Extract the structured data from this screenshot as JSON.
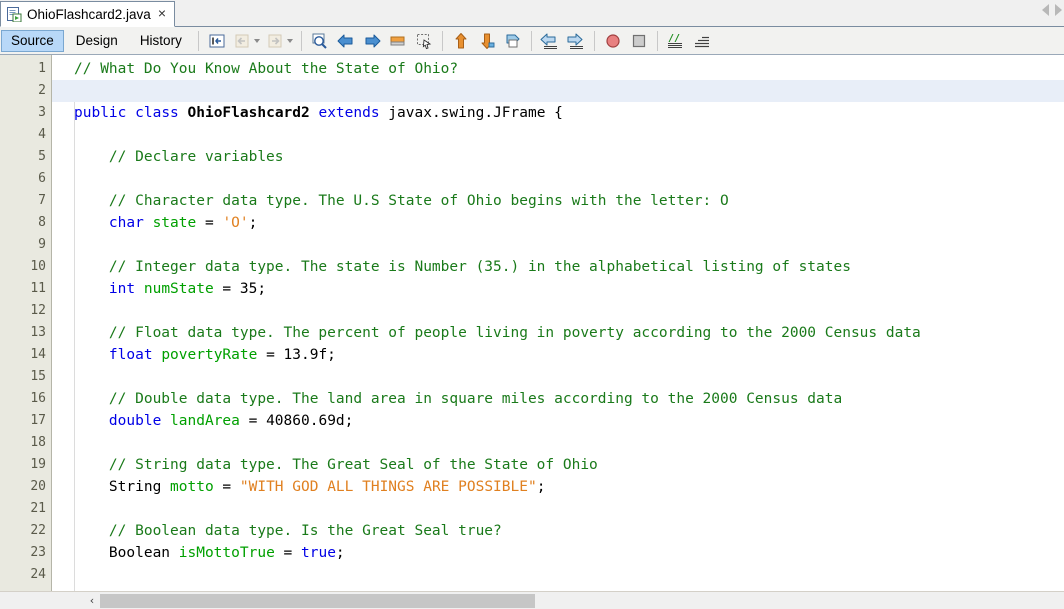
{
  "window": {
    "tab": {
      "title": "OhioFlashcard2.java",
      "close_label": "×",
      "icon": "java-file-icon"
    },
    "tab_nav": {
      "left": "scroll-tabs-left",
      "right": "scroll-tabs-right"
    }
  },
  "view_tabs": [
    {
      "label": "Source",
      "active": true
    },
    {
      "label": "Design",
      "active": false
    },
    {
      "label": "History",
      "active": false
    }
  ],
  "toolbar": {
    "groups": [
      {
        "buttons": [
          {
            "name": "last-edit-icon",
            "enabled": true
          },
          {
            "name": "back-icon",
            "enabled": false,
            "has_caret": true
          },
          {
            "name": "forward-icon",
            "enabled": false,
            "has_caret": true
          }
        ]
      },
      {
        "buttons": [
          {
            "name": "find-selection-icon",
            "enabled": true
          },
          {
            "name": "find-previous-icon",
            "enabled": true
          },
          {
            "name": "find-next-icon",
            "enabled": true
          },
          {
            "name": "toggle-highlight-icon",
            "enabled": true
          },
          {
            "name": "toggle-rectangular-selection-icon",
            "enabled": true
          }
        ]
      },
      {
        "buttons": [
          {
            "name": "previous-bookmark-icon",
            "enabled": true
          },
          {
            "name": "next-bookmark-icon",
            "enabled": true
          },
          {
            "name": "toggle-bookmark-icon",
            "enabled": true
          }
        ]
      },
      {
        "buttons": [
          {
            "name": "shift-line-left-icon",
            "enabled": true
          },
          {
            "name": "shift-line-right-icon",
            "enabled": true
          }
        ]
      },
      {
        "buttons": [
          {
            "name": "start-macro-recording-icon",
            "enabled": true
          },
          {
            "name": "stop-macro-recording-icon",
            "enabled": true
          }
        ]
      },
      {
        "buttons": [
          {
            "name": "comment-icon",
            "enabled": true
          },
          {
            "name": "uncomment-icon",
            "enabled": true
          }
        ]
      }
    ]
  },
  "editor": {
    "current_line": 2,
    "colors": {
      "keyword": "#0000e6",
      "comment": "#1a7a1a",
      "string": "#e08020",
      "variable": "#00a000",
      "class": "#000000",
      "current_line_bg": "#e8eef8",
      "gutter_bg": "#e9e9e0"
    },
    "line_numbers": [
      1,
      2,
      3,
      4,
      5,
      6,
      7,
      8,
      9,
      10,
      11,
      12,
      13,
      14,
      15,
      16,
      17,
      18,
      19,
      20,
      21,
      22,
      23,
      24
    ],
    "lines": [
      {
        "n": 1,
        "tokens": [
          {
            "t": "cmt",
            "s": "// What Do You Know About the State of Ohio?"
          }
        ]
      },
      {
        "n": 2,
        "tokens": []
      },
      {
        "n": 3,
        "tokens": [
          {
            "t": "kw",
            "s": "public"
          },
          {
            "t": "plain",
            "s": " "
          },
          {
            "t": "kw",
            "s": "class"
          },
          {
            "t": "plain",
            "s": " "
          },
          {
            "t": "cls",
            "s": "OhioFlashcard2"
          },
          {
            "t": "plain",
            "s": " "
          },
          {
            "t": "kw",
            "s": "extends"
          },
          {
            "t": "plain",
            "s": " javax.swing.JFrame {"
          }
        ]
      },
      {
        "n": 4,
        "tokens": []
      },
      {
        "n": 5,
        "tokens": [
          {
            "t": "plain",
            "s": "    "
          },
          {
            "t": "cmt",
            "s": "// Declare variables"
          }
        ]
      },
      {
        "n": 6,
        "tokens": []
      },
      {
        "n": 7,
        "tokens": [
          {
            "t": "plain",
            "s": "    "
          },
          {
            "t": "cmt",
            "s": "// Character data type. The U.S State of Ohio begins with the letter: O"
          }
        ]
      },
      {
        "n": 8,
        "tokens": [
          {
            "t": "plain",
            "s": "    "
          },
          {
            "t": "kw",
            "s": "char"
          },
          {
            "t": "plain",
            "s": " "
          },
          {
            "t": "var",
            "s": "state"
          },
          {
            "t": "plain",
            "s": " = "
          },
          {
            "t": "str",
            "s": "'O'"
          },
          {
            "t": "plain",
            "s": ";"
          }
        ]
      },
      {
        "n": 9,
        "tokens": []
      },
      {
        "n": 10,
        "tokens": [
          {
            "t": "plain",
            "s": "    "
          },
          {
            "t": "cmt",
            "s": "// Integer data type. The state is Number (35.) in the alphabetical listing of states"
          }
        ]
      },
      {
        "n": 11,
        "tokens": [
          {
            "t": "plain",
            "s": "    "
          },
          {
            "t": "kw",
            "s": "int"
          },
          {
            "t": "plain",
            "s": " "
          },
          {
            "t": "var",
            "s": "numState"
          },
          {
            "t": "plain",
            "s": " = 35;"
          }
        ]
      },
      {
        "n": 12,
        "tokens": []
      },
      {
        "n": 13,
        "tokens": [
          {
            "t": "plain",
            "s": "    "
          },
          {
            "t": "cmt",
            "s": "// Float data type. The percent of people living in poverty according to the 2000 Census data"
          }
        ]
      },
      {
        "n": 14,
        "tokens": [
          {
            "t": "plain",
            "s": "    "
          },
          {
            "t": "kw",
            "s": "float"
          },
          {
            "t": "plain",
            "s": " "
          },
          {
            "t": "var",
            "s": "povertyRate"
          },
          {
            "t": "plain",
            "s": " = 13.9f;"
          }
        ]
      },
      {
        "n": 15,
        "tokens": []
      },
      {
        "n": 16,
        "tokens": [
          {
            "t": "plain",
            "s": "    "
          },
          {
            "t": "cmt",
            "s": "// Double data type. The land area in square miles according to the 2000 Census data"
          }
        ]
      },
      {
        "n": 17,
        "tokens": [
          {
            "t": "plain",
            "s": "    "
          },
          {
            "t": "kw",
            "s": "double"
          },
          {
            "t": "plain",
            "s": " "
          },
          {
            "t": "var",
            "s": "landArea"
          },
          {
            "t": "plain",
            "s": " = 40860.69d;"
          }
        ]
      },
      {
        "n": 18,
        "tokens": []
      },
      {
        "n": 19,
        "tokens": [
          {
            "t": "plain",
            "s": "    "
          },
          {
            "t": "cmt",
            "s": "// String data type. The Great Seal of the State of Ohio"
          }
        ]
      },
      {
        "n": 20,
        "tokens": [
          {
            "t": "plain",
            "s": "    String "
          },
          {
            "t": "var",
            "s": "motto"
          },
          {
            "t": "plain",
            "s": " = "
          },
          {
            "t": "str",
            "s": "\"WITH GOD ALL THINGS ARE POSSIBLE\""
          },
          {
            "t": "plain",
            "s": ";"
          }
        ]
      },
      {
        "n": 21,
        "tokens": []
      },
      {
        "n": 22,
        "tokens": [
          {
            "t": "plain",
            "s": "    "
          },
          {
            "t": "cmt",
            "s": "// Boolean data type. Is the Great Seal true?"
          }
        ]
      },
      {
        "n": 23,
        "tokens": [
          {
            "t": "plain",
            "s": "    Boolean "
          },
          {
            "t": "var",
            "s": "isMottoTrue"
          },
          {
            "t": "plain",
            "s": " = "
          },
          {
            "t": "kw",
            "s": "true"
          },
          {
            "t": "plain",
            "s": ";"
          }
        ]
      },
      {
        "n": 24,
        "tokens": []
      }
    ]
  },
  "scrollbar": {
    "left_arrow": "‹",
    "thumb_name": "horizontal-scroll-thumb"
  }
}
